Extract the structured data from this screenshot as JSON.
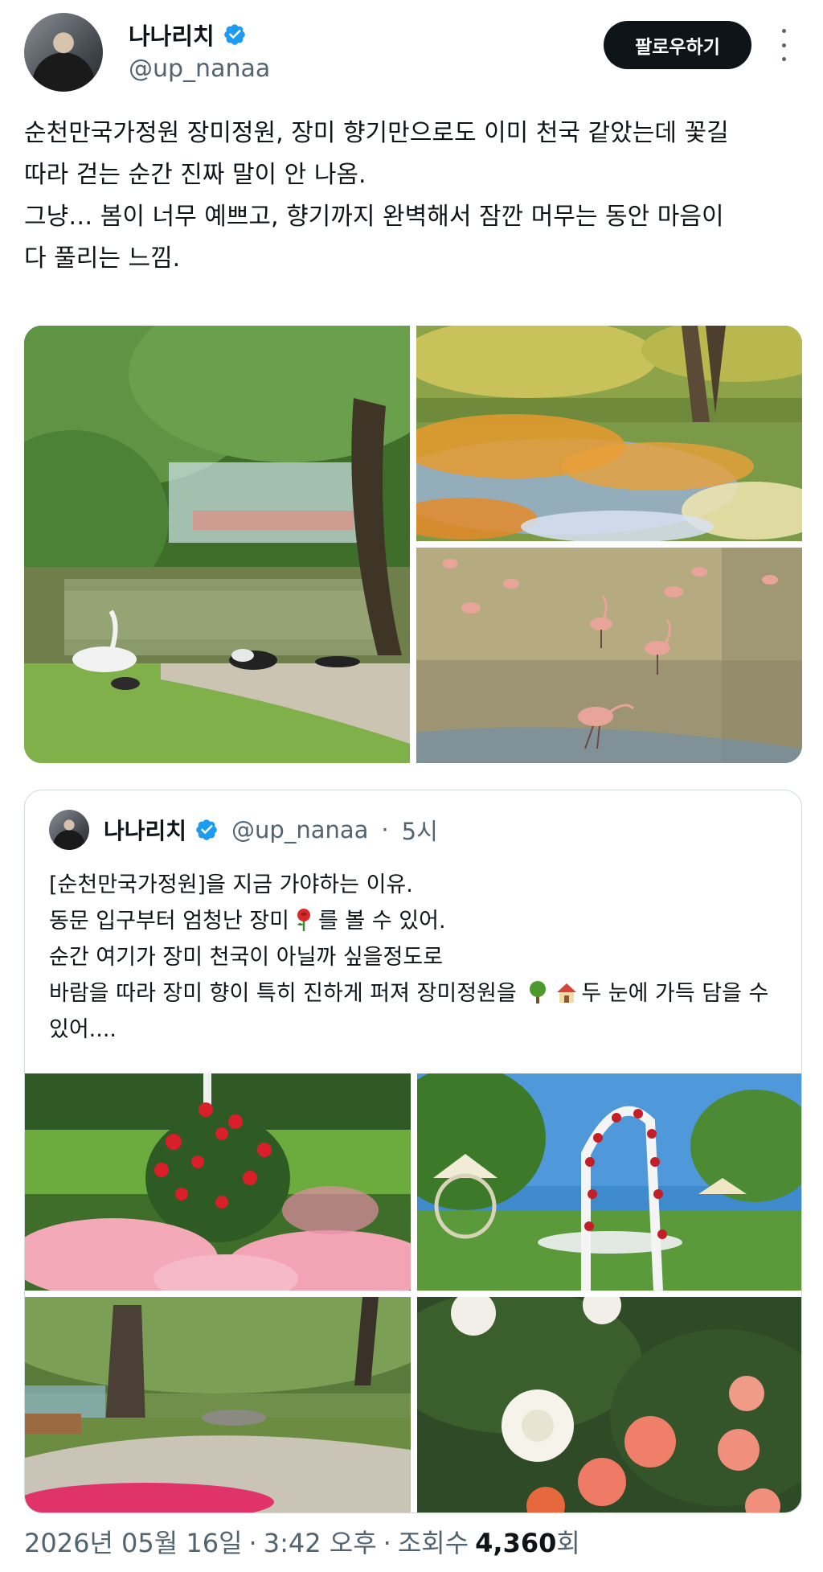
{
  "author": {
    "name": "나나리치",
    "handle": "@up_nanaa",
    "verified": true
  },
  "actions": {
    "follow_label": "팔로우하기",
    "more_icon": "more-vertical-icon"
  },
  "tweet": {
    "lines": [
      "순천만국가정원 장미정원, 장미 향기만으로도 이미 천국 같았는데 꽃길",
      "따라 걷는 순간 진짜 말이 안 나옴.",
      "그냥… 봄이 너무 예쁘고, 향기까지 완벽해서 잠깐 머무는 동안 마음이",
      "다 풀리는 느낌."
    ],
    "photos": [
      "pond-with-ducks-and-tree",
      "wildflower-field",
      "flamingos-in-water"
    ]
  },
  "quote": {
    "name": "나나리치",
    "handle": "@up_nanaa",
    "sep": "·",
    "time": "5시",
    "line1": "[순천만국가정원]을 지금 가야하는 이유.",
    "line2_a": "동문 입구부터 엄청난 장미",
    "line2_b": "를 볼 수 있어.",
    "line3": "순간 여기가 장미 천국이 아닐까 싶을정도로",
    "line4_a": "바람을 따라 장미 향이 특히 진하게 퍼져 장미정원을",
    "line4_b": "두 눈에 가득 담을 수",
    "line5": "있어....",
    "emoji": [
      "rose-emoji",
      "tree-emoji",
      "house-emoji"
    ],
    "photos": [
      "red-and-pink-roses",
      "rose-arch",
      "willow-path",
      "white-and-coral-roses"
    ]
  },
  "footer": {
    "date": "2026년 05월 16일",
    "sep1": "·",
    "time": "3:42 오후",
    "sep2": "·",
    "views_label": "조회수",
    "views_count": "4,360",
    "views_unit": "회"
  },
  "colors": {
    "text": "#0f1419",
    "secondary": "#536471",
    "verified_blue": "#1d9bf0",
    "border": "#cfd9de"
  }
}
